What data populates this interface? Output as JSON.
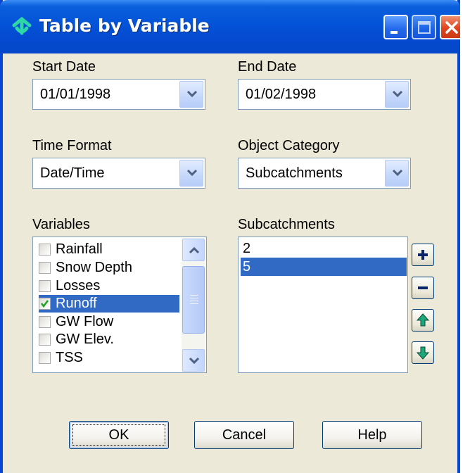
{
  "window": {
    "title": "Table by Variable",
    "icons": {
      "app": "swmm-app-icon",
      "minimize": "minimize-icon",
      "maximize": "maximize-icon",
      "close": "close-icon"
    }
  },
  "start_date": {
    "label": "Start Date",
    "value": "01/01/1998"
  },
  "end_date": {
    "label": "End Date",
    "value": "01/02/1998"
  },
  "time_format": {
    "label": "Time Format",
    "value": "Date/Time"
  },
  "object_category": {
    "label": "Object Category",
    "value": "Subcatchments"
  },
  "variables": {
    "label": "Variables",
    "items": [
      {
        "label": "Rainfall",
        "checked": false,
        "selected": false
      },
      {
        "label": "Snow Depth",
        "checked": false,
        "selected": false
      },
      {
        "label": "Losses",
        "checked": false,
        "selected": false
      },
      {
        "label": "Runoff",
        "checked": true,
        "selected": true
      },
      {
        "label": "GW Flow",
        "checked": false,
        "selected": false
      },
      {
        "label": "GW Elev.",
        "checked": false,
        "selected": false
      },
      {
        "label": "TSS",
        "checked": false,
        "selected": false
      }
    ]
  },
  "subcatchments": {
    "label": "Subcatchments",
    "items": [
      {
        "label": "2",
        "selected": false
      },
      {
        "label": "5",
        "selected": true
      }
    ],
    "buttons": [
      "add-icon",
      "remove-icon",
      "move-up-icon",
      "move-down-icon"
    ]
  },
  "buttons": {
    "ok": "OK",
    "cancel": "Cancel",
    "help": "Help"
  },
  "colors": {
    "titlebar": "#0453d8",
    "selection": "#316ac5",
    "dialog_bg": "#ece9d8",
    "icon_green": "#1ea87a",
    "icon_navy": "#0a246a"
  }
}
